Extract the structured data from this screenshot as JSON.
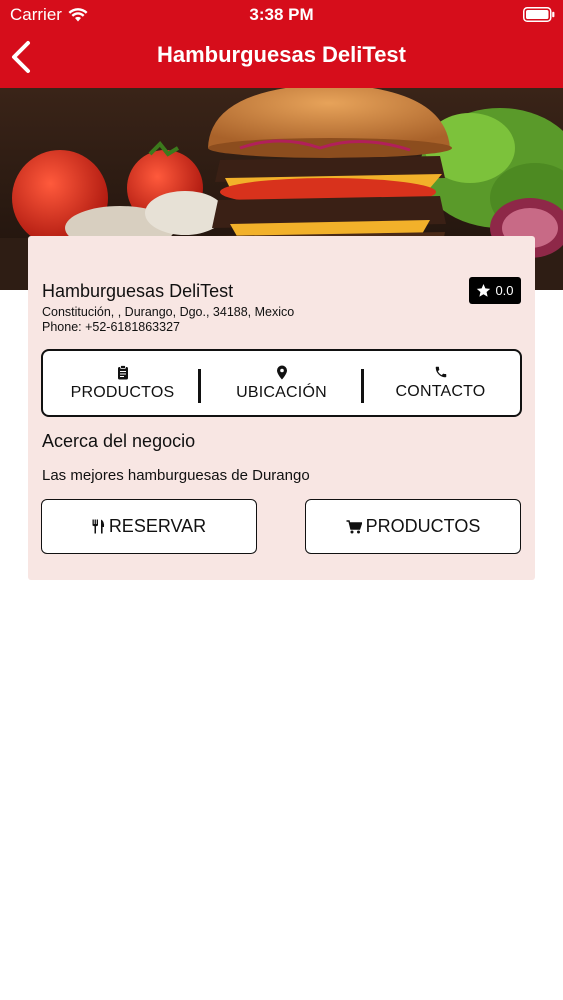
{
  "status_bar": {
    "carrier": "Carrier",
    "time": "3:38 PM"
  },
  "nav": {
    "title": "Hamburguesas DeliTest",
    "back_icon": "chevron-left-icon"
  },
  "business": {
    "name": "Hamburguesas DeliTest",
    "address": "Constitución, , Durango, Dgo., 34188, Mexico",
    "phone": "Phone: +52-6181863327",
    "rating": "0.0"
  },
  "tabs": [
    {
      "label": "PRODUCTOS",
      "icon": "clipboard-icon"
    },
    {
      "label": "UBICACIÓN",
      "icon": "map-pin-icon"
    },
    {
      "label": "CONTACTO",
      "icon": "phone-icon"
    }
  ],
  "about": {
    "title": "Acerca del negocio",
    "text": "Las mejores hamburguesas de Durango"
  },
  "actions": {
    "reserve_label": "RESERVAR",
    "products_label": "PRODUCTOS"
  },
  "colors": {
    "brand_red": "#d60d1b",
    "card_bg": "#f8e6e3"
  }
}
